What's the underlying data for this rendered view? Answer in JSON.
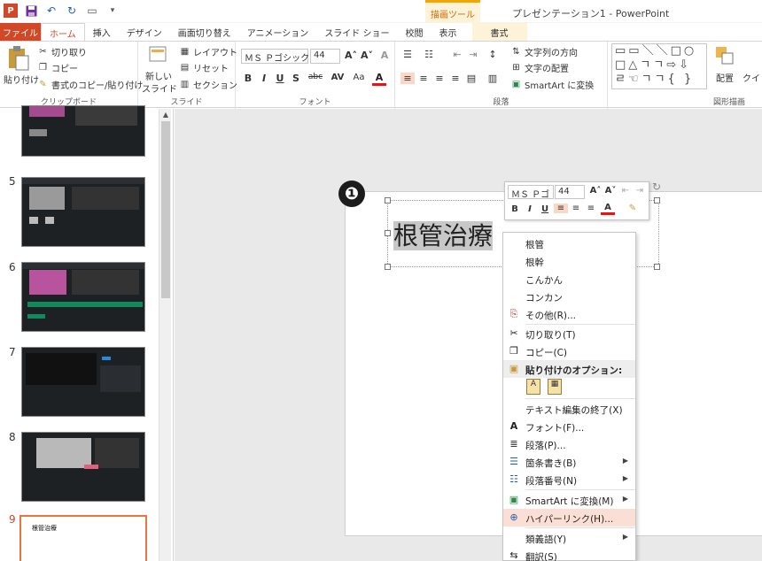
{
  "window": {
    "title": "プレゼンテーション1 - PowerPoint",
    "tool_group": "描画ツール"
  },
  "tabs": [
    "ファイル",
    "ホーム",
    "挿入",
    "デザイン",
    "画面切り替え",
    "アニメーション",
    "スライド ショー",
    "校閲",
    "表示",
    "書式"
  ],
  "ribbon": {
    "clipboard": {
      "paste": "貼り付け",
      "cut": "切り取り",
      "copy": "コピー",
      "format_painter": "書式のコピー/貼り付け",
      "label": "クリップボード"
    },
    "slides": {
      "new_slide_1": "新しい",
      "new_slide_2": "スライド",
      "layout": "レイアウト",
      "reset": "リセット",
      "section": "セクション",
      "label": "スライド"
    },
    "font": {
      "font_name": "ＭＳ Ｐゴシック",
      "font_size": "44",
      "label": "フォント"
    },
    "paragraph": {
      "text_direction": "文字列の方向",
      "align_text": "文字の配置",
      "smartart": "SmartArt に変換",
      "label": "段落"
    },
    "drawing": {
      "arrange": "配置",
      "quick_styles": "クイック スタイル",
      "label": "図形描画"
    }
  },
  "slides": [
    {
      "num": "5"
    },
    {
      "num": "6"
    },
    {
      "num": "7"
    },
    {
      "num": "8"
    },
    {
      "num": "9",
      "title": "根管治療"
    }
  ],
  "slide": {
    "title_selected": "根管治療",
    "step_badge": "❶"
  },
  "mini_toolbar": {
    "font_name": "ＭＳ Ｐゴ",
    "font_size": "44"
  },
  "context_menu": {
    "suggestions": [
      "根管",
      "根幹",
      "こんかん",
      "コンカン"
    ],
    "other": "その他(R)...",
    "cut": "切り取り(T)",
    "copy": "コピー(C)",
    "paste_options": "貼り付けのオプション:",
    "exit_edit": "テキスト編集の終了(X)",
    "font": "フォント(F)...",
    "paragraph": "段落(P)...",
    "bullets": "箇条書き(B)",
    "numbering": "段落番号(N)",
    "smartart": "SmartArt に変換(M)",
    "hyperlink": "ハイパーリンク(H)...",
    "synonyms": "類義語(Y)",
    "translate": "翻訳(S)"
  },
  "colors": {
    "accent": "#d24726",
    "menu_highlight": "#fcdfd4",
    "tool_tab": "#fdf3d8"
  }
}
